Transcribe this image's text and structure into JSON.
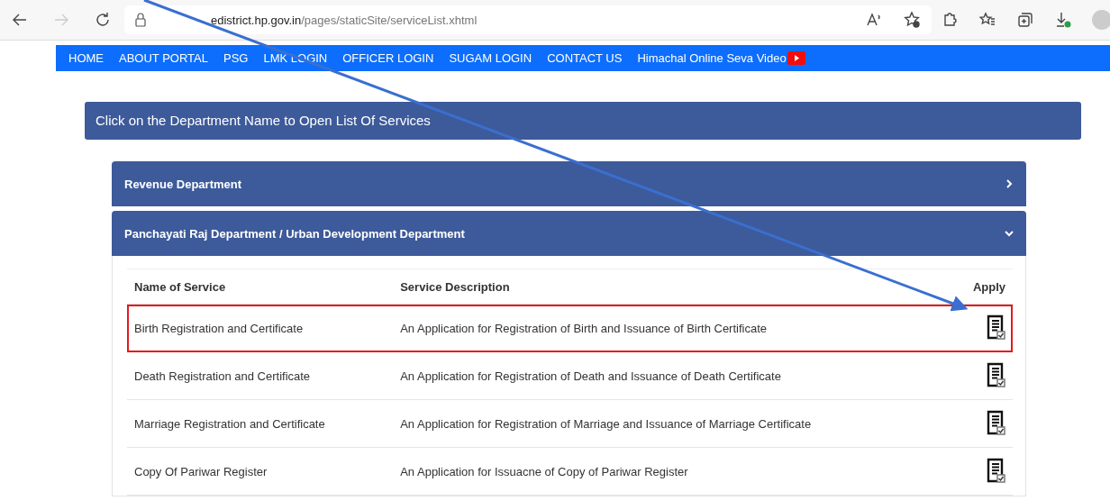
{
  "browser": {
    "url_host": "edistrict.hp.gov.in",
    "url_path": "/pages/staticSite/serviceList.xhtml",
    "forward_disabled": true
  },
  "nav": [
    {
      "label": "HOME",
      "kind": "link"
    },
    {
      "label": "ABOUT PORTAL",
      "kind": "link"
    },
    {
      "label": "PSG",
      "kind": "link"
    },
    {
      "label": "LMK LOGIN",
      "kind": "link"
    },
    {
      "label": "OFFICER LOGIN",
      "kind": "link"
    },
    {
      "label": "SUGAM LOGIN",
      "kind": "link"
    },
    {
      "label": "CONTACT US",
      "kind": "link"
    },
    {
      "label": "Himachal Online Seva Video",
      "kind": "video"
    }
  ],
  "banner": "Click on the Department Name to Open List Of Services",
  "departments": [
    {
      "name": "Revenue Department",
      "expanded": false
    },
    {
      "name": "Panchayati Raj Department / Urban Development Department",
      "expanded": true
    }
  ],
  "table": {
    "columns": [
      "Name of Service",
      "Service Description",
      "Apply"
    ],
    "rows": [
      {
        "service": "Birth Registration and Certificate",
        "description": "An Application for Registration of Birth and Issuance of Birth Certificate",
        "highlighted": true
      },
      {
        "service": "Death Registration and Certificate",
        "description": "An Application for Registration of Death and Issuance of Death Certificate",
        "highlighted": false
      },
      {
        "service": "Marriage Registration and Certificate",
        "description": "An Application for Registration of Marriage and Issuance of Marriage Certificate",
        "highlighted": false
      },
      {
        "service": "Copy Of Pariwar Register",
        "description": "An Application for Issuacne of Copy of Pariwar Register",
        "highlighted": false
      }
    ]
  },
  "annotation": {
    "arrow": true
  }
}
